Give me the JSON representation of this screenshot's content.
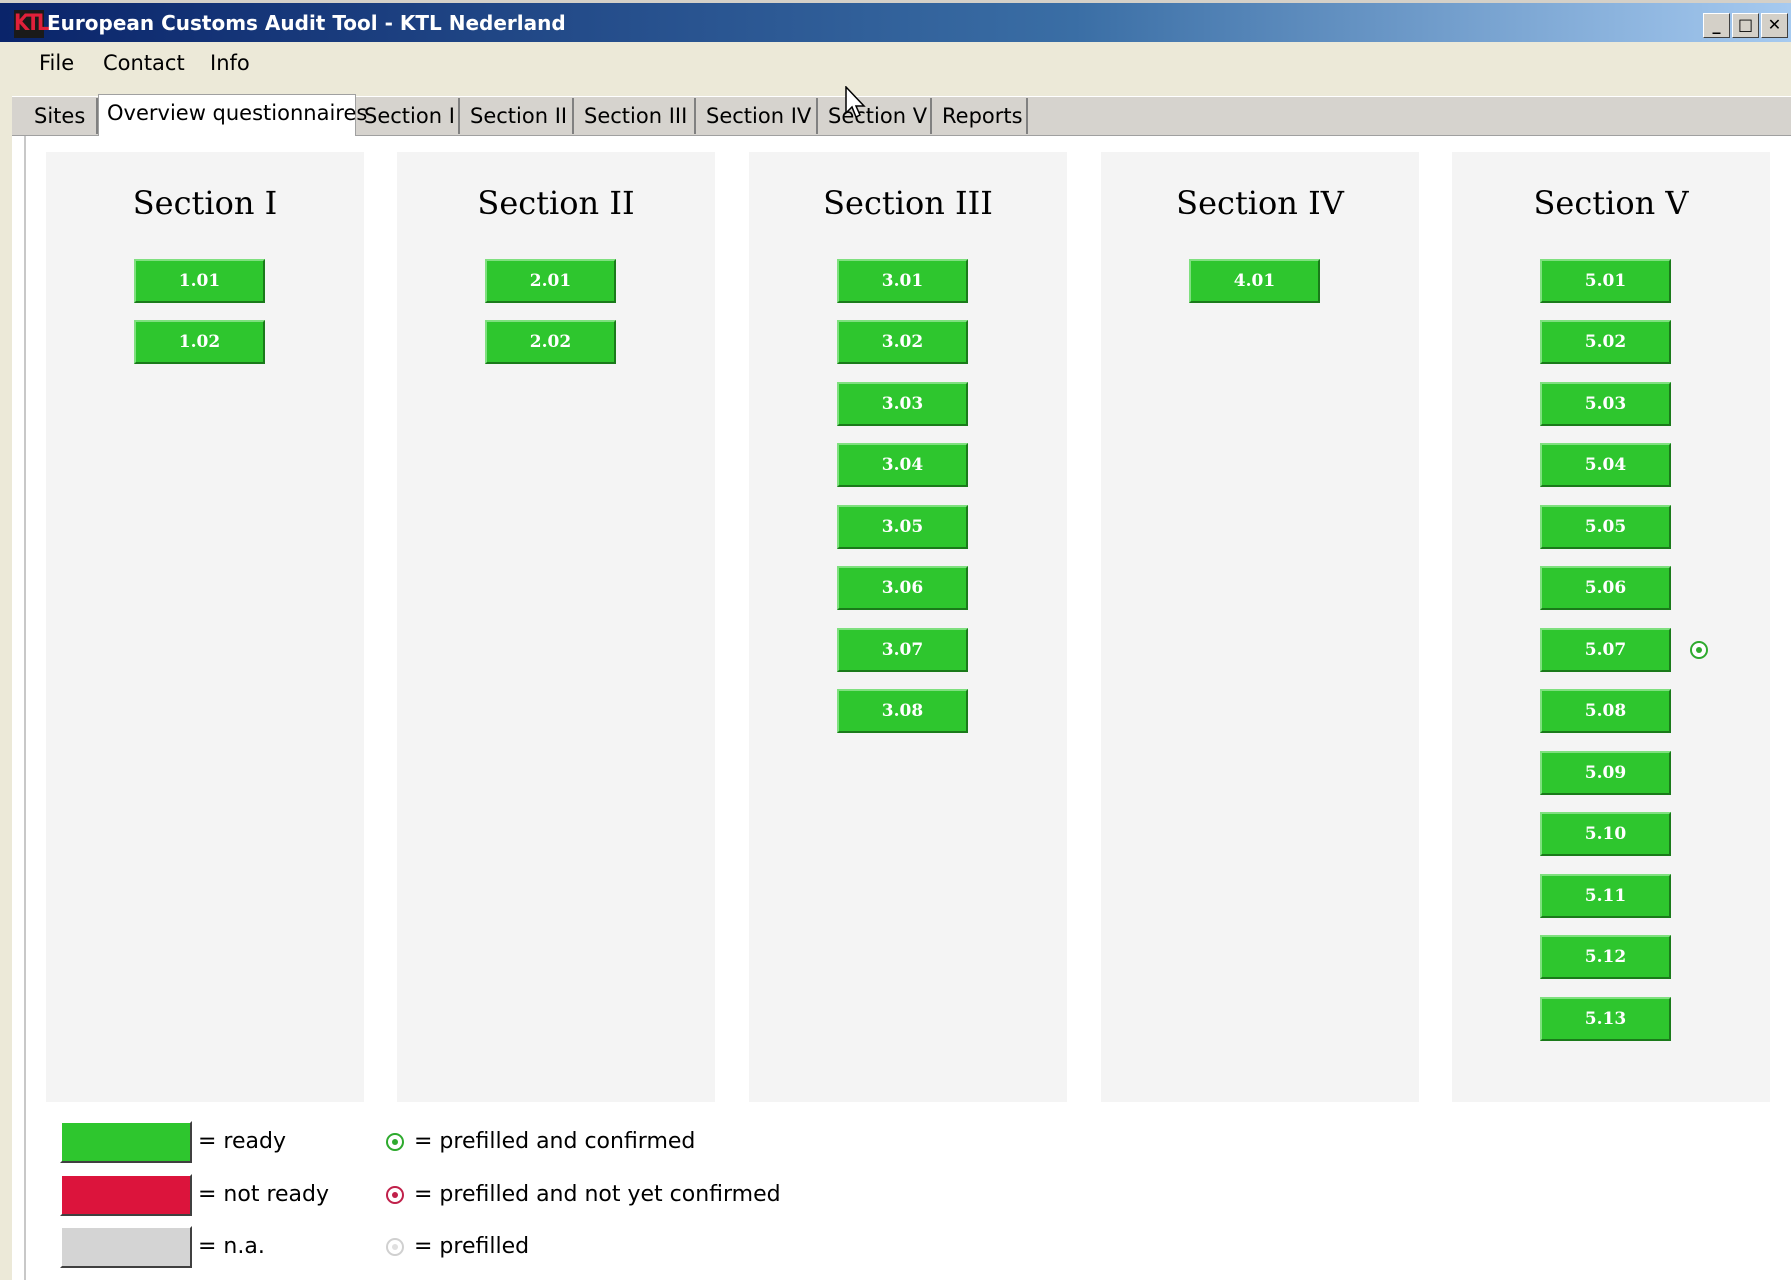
{
  "window": {
    "logo_text": "KTL",
    "title": "European Customs Audit Tool - KTL Nederland",
    "controls": [
      "_",
      "□",
      "✕"
    ]
  },
  "menu": [
    "File",
    "Contact",
    "Info"
  ],
  "tabs": [
    {
      "label": "Sites",
      "active": false
    },
    {
      "label": "Overview questionnaires",
      "active": true
    },
    {
      "label": "Section I",
      "active": false
    },
    {
      "label": "Section II",
      "active": false
    },
    {
      "label": "Section III",
      "active": false
    },
    {
      "label": "Section IV",
      "active": false
    },
    {
      "label": "Section V",
      "active": false
    },
    {
      "label": "Reports",
      "active": false
    }
  ],
  "sections": [
    {
      "title": "Section I",
      "items": [
        "1.01",
        "1.02"
      ]
    },
    {
      "title": "Section II",
      "items": [
        "2.01",
        "2.02"
      ]
    },
    {
      "title": "Section III",
      "items": [
        "3.01",
        "3.02",
        "3.03",
        "3.04",
        "3.05",
        "3.06",
        "3.07",
        "3.08"
      ]
    },
    {
      "title": "Section IV",
      "items": [
        "4.01"
      ]
    },
    {
      "title": "Section V",
      "items": [
        "5.01",
        "5.02",
        "5.03",
        "5.04",
        "5.05",
        "5.06",
        "5.07",
        "5.08",
        "5.09",
        "5.10",
        "5.11",
        "5.12",
        "5.13"
      ]
    }
  ],
  "item_status": {
    "color_ready": "#2ec62e"
  },
  "prefilled_marker": {
    "section": "Section V",
    "item": "5.07",
    "state": "prefilled and confirmed"
  },
  "legend": {
    "status": [
      {
        "color": "#2ec62e",
        "label": "= ready"
      },
      {
        "color": "#dc143c",
        "label": "= not ready"
      },
      {
        "color": "#d4d4d4",
        "label": "= n.a."
      }
    ],
    "prefill": [
      {
        "icon": "radio-green-icon",
        "label": "= prefilled and confirmed"
      },
      {
        "icon": "radio-red-icon",
        "label": "= prefilled and not yet confirmed"
      },
      {
        "icon": "radio-grey-icon",
        "label": "= prefilled"
      }
    ]
  }
}
